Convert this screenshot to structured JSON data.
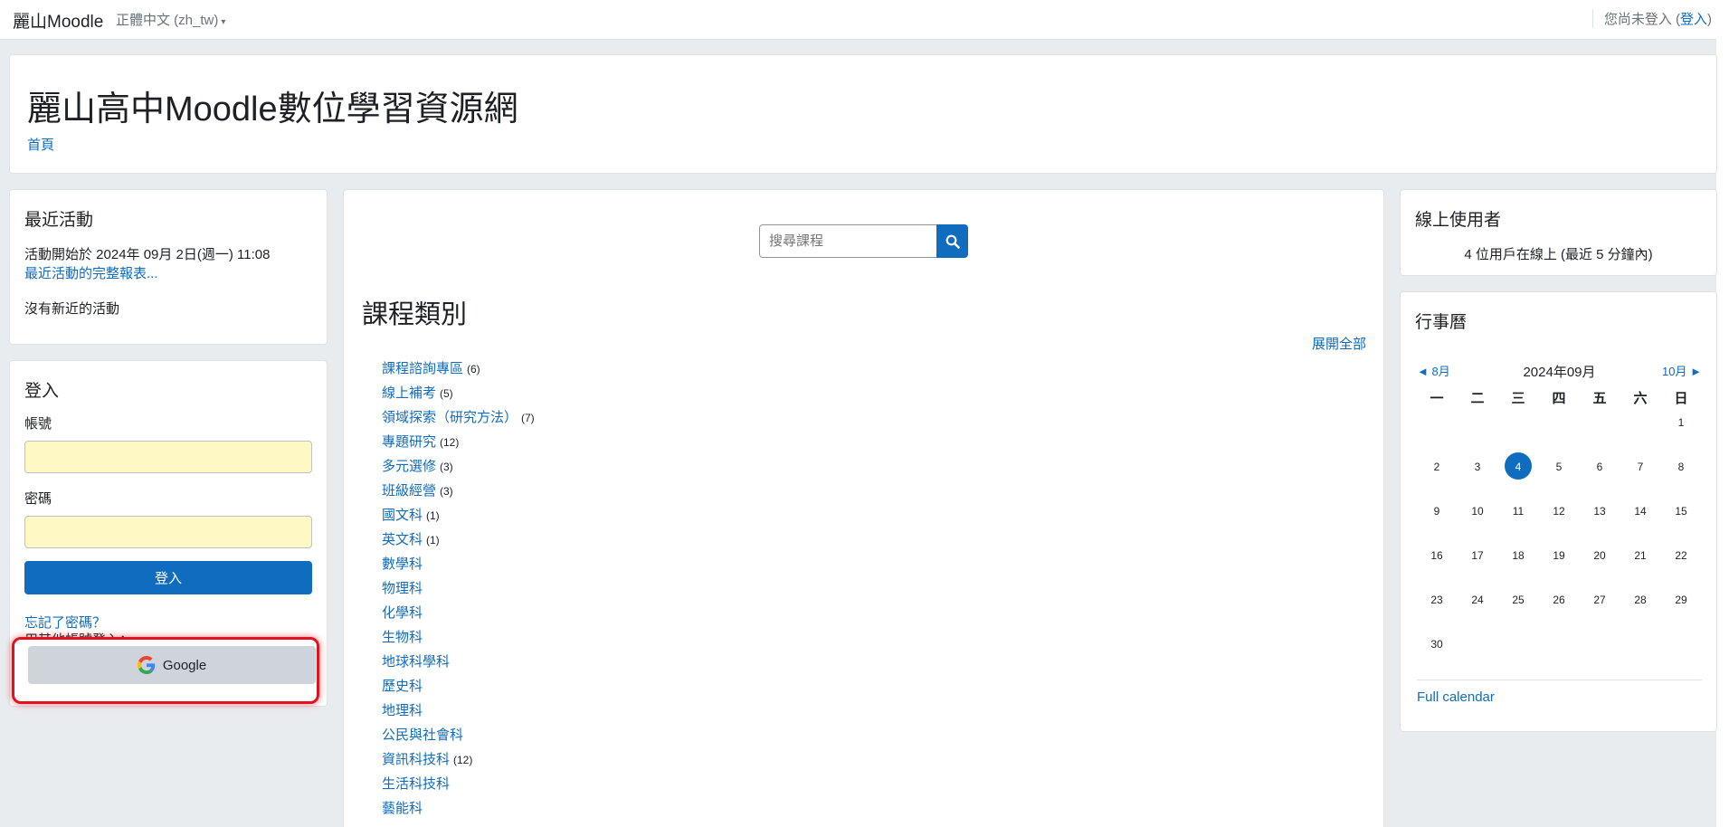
{
  "navbar": {
    "brand": "麗山Moodle",
    "language": "正體中文 (zh_tw)",
    "not_logged": "您尚未登入 (",
    "login_link": "登入",
    "close_paren": ")"
  },
  "header": {
    "site_title": "麗山高中Moodle數位學習資源網",
    "breadcrumb_home": "首頁"
  },
  "recent_activity": {
    "title": "最近活動",
    "since": "活動開始於 2024年 09月 2日(週一) 11:08",
    "full_report": "最近活動的完整報表...",
    "no_activity": "沒有新近的活動"
  },
  "login_block": {
    "title": "登入",
    "username_label": "帳號",
    "password_label": "密碼",
    "login_button": "登入",
    "forgot": "忘記了密碼？",
    "other_accounts": "用其他帳號登入：",
    "google_button": "Google"
  },
  "main": {
    "search_placeholder": "搜尋課程",
    "category_title": "課程類別",
    "expand_all": "展開全部",
    "categories": [
      {
        "name": "課程諮詢專區",
        "count": "(6)"
      },
      {
        "name": "線上補考",
        "count": "(5)"
      },
      {
        "name": "領域探索（研究方法）",
        "count": "(7)"
      },
      {
        "name": "專題研究",
        "count": "(12)"
      },
      {
        "name": "多元選修",
        "count": "(3)"
      },
      {
        "name": "班級經營",
        "count": "(3)"
      },
      {
        "name": "國文科",
        "count": "(1)"
      },
      {
        "name": "英文科",
        "count": "(1)"
      },
      {
        "name": "數學科",
        "count": ""
      },
      {
        "name": "物理科",
        "count": ""
      },
      {
        "name": "化學科",
        "count": ""
      },
      {
        "name": "生物科",
        "count": ""
      },
      {
        "name": "地球科學科",
        "count": ""
      },
      {
        "name": "歷史科",
        "count": ""
      },
      {
        "name": "地理科",
        "count": ""
      },
      {
        "name": "公民與社會科",
        "count": ""
      },
      {
        "name": "資訊科技科",
        "count": "(12)"
      },
      {
        "name": "生活科技科",
        "count": ""
      },
      {
        "name": "藝能科",
        "count": ""
      }
    ]
  },
  "online_users": {
    "title": "線上使用者",
    "text": "4 位用戶在線上 (最近 5 分鐘內)"
  },
  "calendar": {
    "title": "行事曆",
    "prev": "◄ 8月",
    "month": "2024年09月",
    "next": "10月 ►",
    "weekdays": [
      "一",
      "二",
      "三",
      "四",
      "五",
      "六",
      "日"
    ],
    "weeks": [
      [
        "",
        "",
        "",
        "",
        "",
        "",
        "1"
      ],
      [
        "2",
        "3",
        "4",
        "5",
        "6",
        "7",
        "8"
      ],
      [
        "9",
        "10",
        "11",
        "12",
        "13",
        "14",
        "15"
      ],
      [
        "16",
        "17",
        "18",
        "19",
        "20",
        "21",
        "22"
      ],
      [
        "23",
        "24",
        "25",
        "26",
        "27",
        "28",
        "29"
      ],
      [
        "30",
        "",
        "",
        "",
        "",
        "",
        ""
      ]
    ],
    "today": "4",
    "full_calendar": "Full calendar"
  }
}
